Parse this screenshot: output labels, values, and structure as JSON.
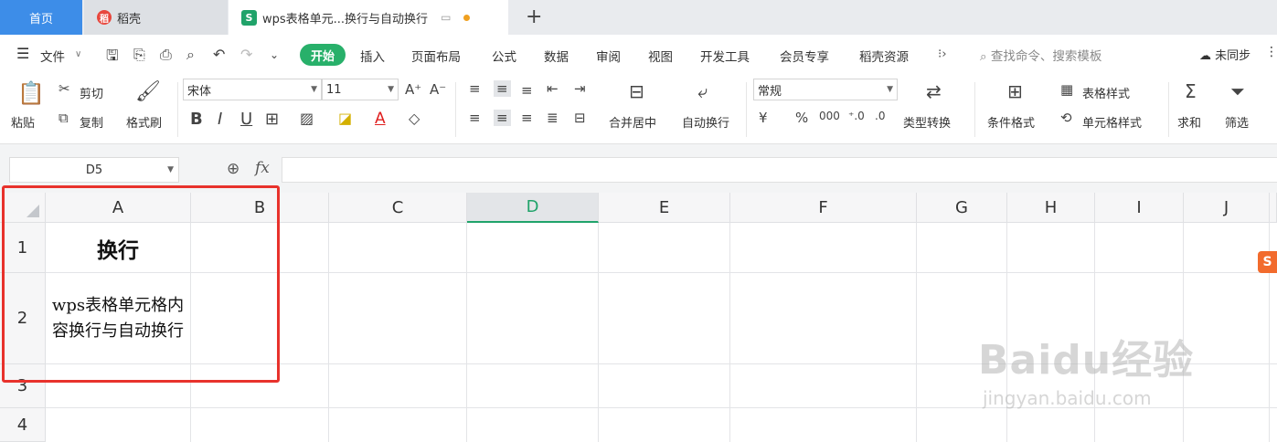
{
  "tabs": {
    "home": "首页",
    "daoke": "稻壳",
    "doc": "wps表格单元...换行与自动换行"
  },
  "menubar": {
    "file": "文件",
    "start": "开始",
    "items": [
      "插入",
      "页面布局",
      "公式",
      "数据",
      "审阅",
      "视图",
      "开发工具",
      "会员专享",
      "稻壳资源"
    ],
    "search_placeholder": "查找命令、搜索模板",
    "sync": "未同步"
  },
  "ribbon": {
    "paste": "粘贴",
    "cut": "剪切",
    "copy": "复制",
    "format_painter": "格式刷",
    "font_name": "宋体",
    "font_size": "11",
    "merge_center": "合并居中",
    "wrap_text": "自动换行",
    "number_format": "常规",
    "type_convert": "类型转换",
    "cond_format": "条件格式",
    "table_style": "表格样式",
    "cell_style": "单元格样式",
    "sum": "求和",
    "filter": "筛选"
  },
  "formula": {
    "namebox": "D5",
    "fx": "fx",
    "content": ""
  },
  "grid": {
    "columns": [
      "A",
      "B",
      "C",
      "D",
      "E",
      "F",
      "G",
      "H",
      "I",
      "J"
    ],
    "rows": [
      "1",
      "2",
      "3",
      "4"
    ],
    "active_column": "D",
    "cells": {
      "A1": "换行",
      "A2": "wps表格单元格内容换行与自动换行"
    }
  },
  "watermark": {
    "brand": "Baidu经验",
    "url": "jingyan.baidu.com"
  },
  "colors": {
    "accent": "#20a36a",
    "home_tab": "#3d8de8",
    "highlight": "#e8322c"
  }
}
